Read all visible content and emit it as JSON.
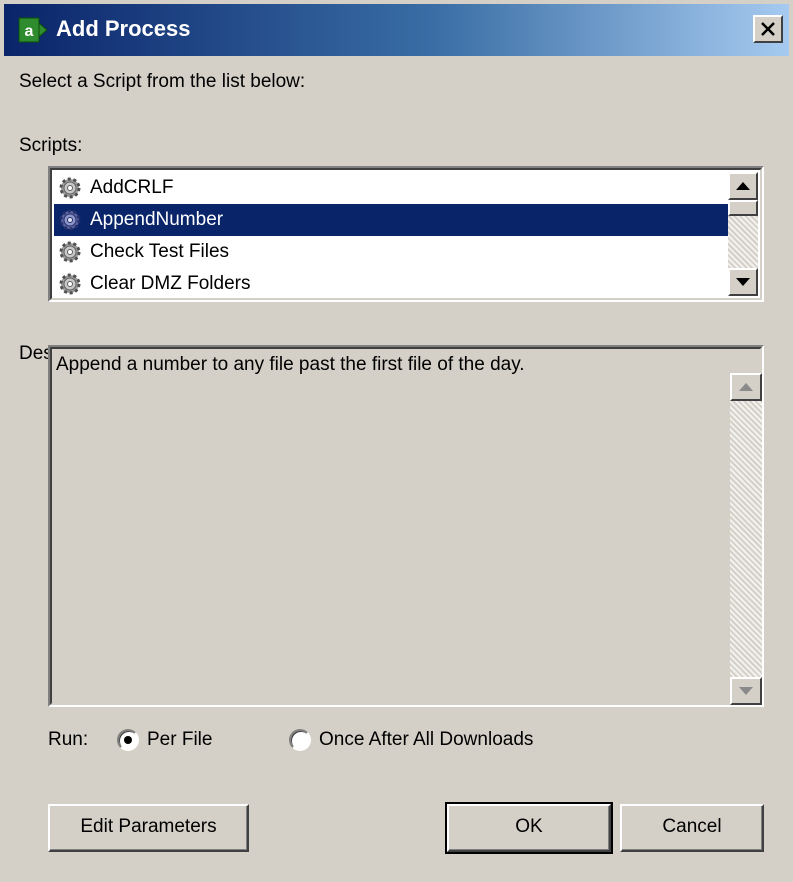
{
  "window": {
    "title": "Add Process",
    "close_glyph": "✕"
  },
  "instruction": "Select a Script from the list below:",
  "scripts": {
    "label": "Scripts:",
    "items": [
      {
        "label": "AddCRLF",
        "selected": false
      },
      {
        "label": "AppendNumber",
        "selected": true
      },
      {
        "label": "Check Test Files",
        "selected": false
      },
      {
        "label": "Clear DMZ Folders",
        "selected": false
      }
    ]
  },
  "description": {
    "label": "Description:",
    "text": "Append a number to any file past the first file of the day."
  },
  "run": {
    "label": "Run:",
    "options": [
      {
        "label": "Per File",
        "checked": true
      },
      {
        "label": "Once After All Downloads",
        "checked": false
      }
    ]
  },
  "buttons": {
    "edit_parameters": "Edit Parameters",
    "ok": "OK",
    "cancel": "Cancel"
  },
  "colors": {
    "selection": "#0a246a",
    "face": "#d4d0c8",
    "title_start": "#0a246a",
    "title_end": "#a6caf0"
  },
  "icons": {
    "app": "app-a-icon",
    "script": "gear-icon"
  }
}
